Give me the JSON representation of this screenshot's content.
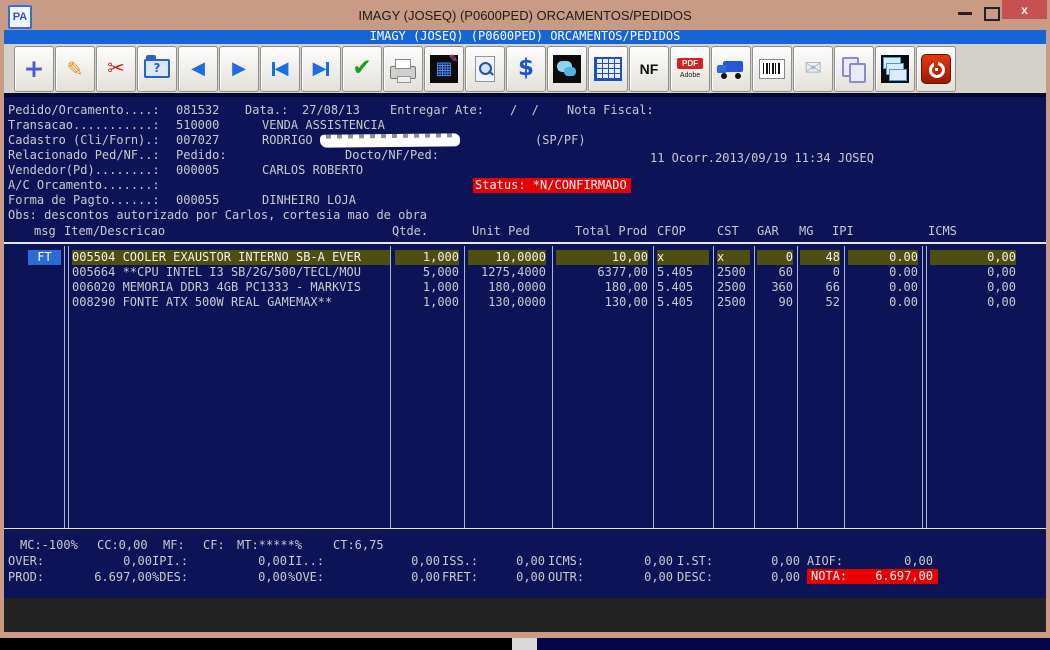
{
  "window": {
    "title": "IMAGY (JOSEQ) (P0600PED) ORCAMENTOS/PEDIDOS",
    "app_icon_text": "PA",
    "close_glyph": "x"
  },
  "inner_titlebar": {
    "title": "IMAGY (JOSEQ) (P0600PED) ORCAMENTOS/PEDIDOS"
  },
  "toolbar": {
    "icons": [
      "new-record-icon",
      "edit-record-icon",
      "cut-icon",
      "open-search-folder-icon",
      "previous-icon",
      "next-icon",
      "first-record-icon",
      "last-record-icon",
      "confirm-icon",
      "print-icon",
      "calculator-icon",
      "search-document-icon",
      "money-icon",
      "chat-icon",
      "spreadsheet-icon",
      "nf-icon",
      "pdf-adobe-icon",
      "truck-icon",
      "barcode-icon",
      "mail-icon",
      "copy-icon",
      "cascade-windows-icon",
      "exit-icon"
    ],
    "glyphs": {
      "plus": "+",
      "edit": "✎",
      "cut": "✂",
      "question": "?",
      "prev": "◀",
      "next": "▶",
      "check": "✔",
      "grid": "▦",
      "pencil": "✎",
      "nf": "NF",
      "pdf": "PDF",
      "adobe": "Adobe",
      "dollar": "$",
      "mail": "✉"
    }
  },
  "header": {
    "pedido_label": "Pedido/Orcamento....:",
    "pedido_value": "081532",
    "data_label": "Data.:",
    "data_value": "27/08/13",
    "entregar_label": "Entregar Ate:",
    "entregar_value": "/  /",
    "nota_fiscal_label": "Nota Fiscal:",
    "transacao_label": "Transacao...........:",
    "transacao_value": "510000",
    "transacao_desc": "VENDA ASSISTENCIA",
    "cadastro_label": "Cadastro (Cli/Forn).:",
    "cadastro_value": "007027",
    "cadastro_name": "RODRIGO",
    "cadastro_tipo": "(SP/PF)",
    "relacionado_label": "Relacionado Ped/NF..:",
    "relacionado_pedido_label": "Pedido:",
    "relacionado_docto_label": "Docto/NF/Ped:",
    "ocorr_text": "11 Ocorr.2013/09/19 11:34 JOSEQ",
    "vendedor_label": "Vendedor(Pd)........:",
    "vendedor_value": "000005",
    "vendedor_name": "CARLOS ROBERTO",
    "ac_label": "A/C Orcamento.......:",
    "status_text": "Status: *N/CONFIRMADO",
    "pagto_label": "Forma de Pagto......:",
    "pagto_value": "000055",
    "pagto_desc": "DINHEIRO LOJA",
    "obs_text": "Obs: descontos autorizado por Carlos, cortesia mao de obra"
  },
  "table": {
    "headers": {
      "msg": "msg",
      "item": "Item/Descricao",
      "qtde": "Qtde.",
      "unit": "Unit Ped",
      "total": "Total Prod",
      "cfop": "CFOP",
      "cst": "CST",
      "gar": "GAR",
      "mg": "MG",
      "ipi": "IPI",
      "icms": "ICMS"
    },
    "badge": "FT",
    "items": [
      {
        "code_desc": "005504 COOLER EXAUSTOR INTERNO SB-A EVER",
        "qtde": "1,000",
        "unit": "10,0000",
        "total": "10,00",
        "cfop": "x",
        "cst": "x",
        "gar": "0",
        "mg": "48",
        "ipi": "0.00",
        "icms": "0,00"
      },
      {
        "code_desc": "005664 **CPU INTEL I3 SB/2G/500/TECL/MOU",
        "qtde": "5,000",
        "unit": "1275,4000",
        "total": "6377,00",
        "cfop": "5.405",
        "cst": "2500",
        "gar": "60",
        "mg": "0",
        "ipi": "0.00",
        "icms": "0,00"
      },
      {
        "code_desc": "006020 MEMORIA DDR3 4GB PC1333 - MARKVIS",
        "qtde": "1,000",
        "unit": "180,0000",
        "total": "180,00",
        "cfop": "5.405",
        "cst": "2500",
        "gar": "360",
        "mg": "66",
        "ipi": "0.00",
        "icms": "0,00"
      },
      {
        "code_desc": "008290 FONTE ATX 500W REAL GAMEMAX**",
        "qtde": "1,000",
        "unit": "130,0000",
        "total": "130,00",
        "cfop": "5.405",
        "cst": "2500",
        "gar": "90",
        "mg": "52",
        "ipi": "0.00",
        "icms": "0,00"
      }
    ]
  },
  "summary": {
    "metrics": [
      "MC:-100%",
      "CC:0,00",
      "MF:",
      "CF:",
      "MT:*****%",
      "CT:6,75"
    ],
    "row2": [
      [
        "OVER:",
        "0,00"
      ],
      [
        "IPI.:",
        "0,00"
      ],
      [
        "II..:",
        "0,00"
      ],
      [
        "ISS.:",
        "0,00"
      ],
      [
        "ICMS:",
        "0,00"
      ],
      [
        "I.ST:",
        "0,00"
      ],
      [
        "AIOF:",
        "0,00"
      ]
    ],
    "row3": [
      [
        "PROD:",
        "6.697,00"
      ],
      [
        "%DES:",
        "0,00"
      ],
      [
        "%OVE:",
        "0,00"
      ],
      [
        "FRET:",
        "0,00"
      ],
      [
        "OUTR:",
        "0,00"
      ],
      [
        "DESC:",
        "0,00"
      ]
    ],
    "nota_label": "NOTA:",
    "nota_value": "6.697,00"
  },
  "colors": {
    "screen_bg": "#0c1457",
    "highlight_olive": "#4f4e12",
    "alert_red": "#e80000",
    "badge_blue": "#2b6bd2",
    "titlebar_tan": "#c99a84",
    "inner_blue": "#1565d8"
  }
}
